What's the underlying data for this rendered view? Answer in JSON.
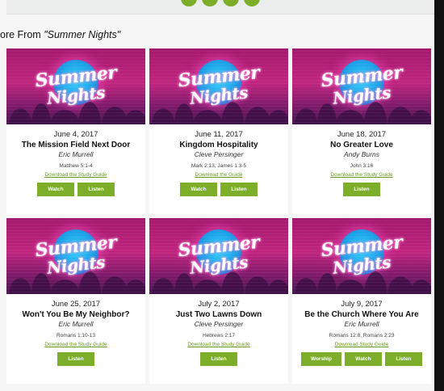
{
  "top": {
    "pager_dots": 4
  },
  "heading": {
    "prefix": "ore From ",
    "series": "\"Summer Nights\""
  },
  "colors": {
    "accent": "#7cae2a",
    "thumb_magenta": "#c0257f",
    "thumb_blue": "#38d4ff"
  },
  "thumbnail": {
    "line1": "Summer",
    "line2": "Nights"
  },
  "cards": [
    {
      "date": "June 4, 2017",
      "title": "The Mission Field Next Door",
      "speaker": "Eric Murrell",
      "scripture": "Matthew 5:1-4",
      "guide": "Download the Study Guide",
      "buttons": [
        "Watch",
        "Listen"
      ]
    },
    {
      "date": "June 11, 2017",
      "title": "Kingdom Hospitality",
      "speaker": "Cleve Persinger",
      "scripture": "Mark 2:13, James 1:3-5",
      "guide": "Download the Guide",
      "buttons": [
        "Watch",
        "Listen"
      ]
    },
    {
      "date": "June 18, 2017",
      "title": "No Greater Love",
      "speaker": "Andy Burns",
      "scripture": "John 3:16",
      "guide": "Download the Study Guide",
      "buttons": [
        "Listen"
      ]
    },
    {
      "date": "June 25, 2017",
      "title": "Won't You Be My Neighbor?",
      "speaker": "Eric Murrell",
      "scripture": "Romans 1:10-13",
      "guide": "Download the Study Guide",
      "buttons": [
        "Listen"
      ]
    },
    {
      "date": "July 2, 2017",
      "title": "Just Two Lawns Down",
      "speaker": "Cleve Persinger",
      "scripture": "Hebrews 2:17",
      "guide": "Download the Study Guide",
      "buttons": [
        "Listen"
      ]
    },
    {
      "date": "July 9, 2017",
      "title": "Be the Church Where You Are",
      "speaker": "Eric Murrell",
      "scripture": "Romans 12:8, Romans 2:23",
      "guide": "Download Study Guide",
      "buttons": [
        "Worship",
        "Watch",
        "Listen"
      ]
    }
  ]
}
